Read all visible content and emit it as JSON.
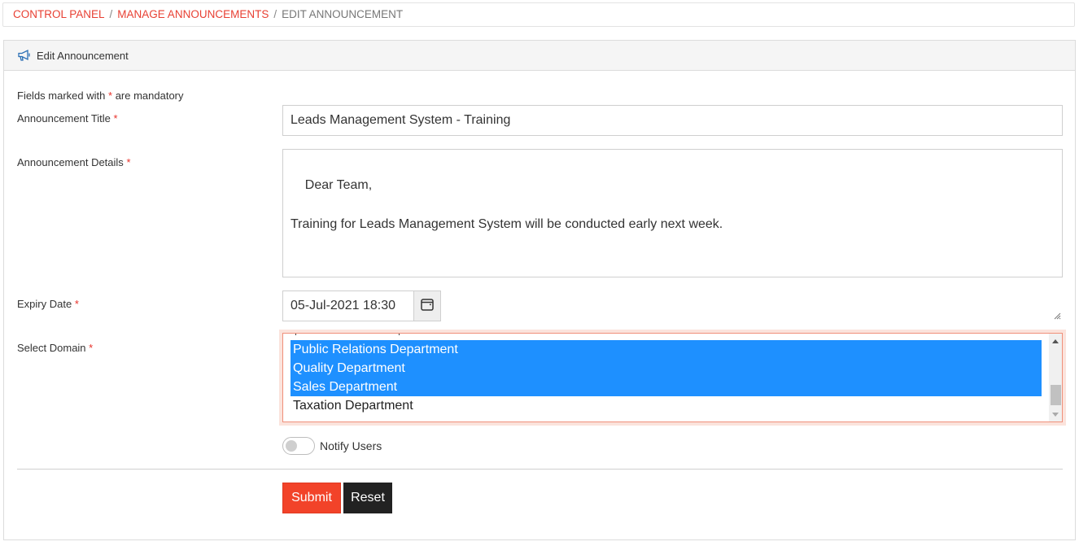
{
  "breadcrumb": {
    "items": [
      {
        "label": "CONTROL PANEL",
        "link": true
      },
      {
        "label": "MANAGE ANNOUNCEMENTS",
        "link": true
      },
      {
        "label": "EDIT ANNOUNCEMENT",
        "link": false
      }
    ],
    "separator": "/"
  },
  "panel": {
    "title": "Edit Announcement",
    "icon": "megaphone-icon"
  },
  "form": {
    "mandatory_note_prefix": "Fields marked with",
    "mandatory_note_suffix": "are mandatory",
    "required_marker": "*",
    "title": {
      "label": "Announcement Title",
      "value": "Leads Management System - Training"
    },
    "details": {
      "label": "Announcement Details",
      "value": "Dear Team,\n\nTraining for Leads Management System will be conducted early next week."
    },
    "expiry": {
      "label": "Expiry Date",
      "value": "05-Jul-2021 18:30",
      "icon": "calendar-icon"
    },
    "domain": {
      "label": "Select Domain",
      "options": [
        {
          "label": "Public Relations Department",
          "selected": true
        },
        {
          "label": "Quality Department",
          "selected": true
        },
        {
          "label": "Sales Department",
          "selected": true
        },
        {
          "label": "Taxation Department",
          "selected": false
        }
      ]
    },
    "notify": {
      "label": "Notify Users",
      "checked": false
    },
    "submit_label": "Submit",
    "reset_label": "Reset"
  },
  "colors": {
    "accent": "#e84033",
    "submit": "#f24329",
    "reset": "#222222",
    "selected_option": "#1e90ff",
    "required": "#e8312a"
  }
}
